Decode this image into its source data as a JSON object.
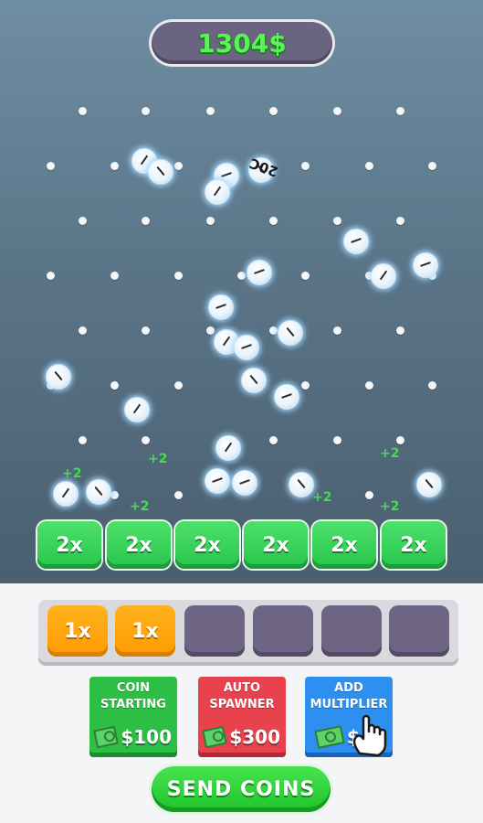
{
  "hud": {
    "money": "1304$"
  },
  "board": {
    "multipliers": [
      "2x",
      "2x",
      "2x",
      "2x",
      "2x",
      "2x"
    ],
    "floating_labels": [
      "20C",
      "+2",
      "+2",
      "+2",
      "+2",
      "+2",
      "+2"
    ]
  },
  "slots": [
    "1x",
    "1x",
    "",
    "",
    "",
    ""
  ],
  "upgrades": [
    {
      "title_line1": "COIN",
      "title_line2": "STARTING",
      "price": "$100",
      "color": "#2dbf44"
    },
    {
      "title_line1": "AUTO",
      "title_line2": "SPAWNER",
      "price": "$300",
      "color": "#e8424f"
    },
    {
      "title_line1": "ADD",
      "title_line2": "MULTIPLIER",
      "price": "$",
      "color": "#2d8ff0"
    }
  ],
  "send_button": "SEND COINS",
  "colors": {
    "money_text": "#5cf25a",
    "multiplier": "#27c54d",
    "slot_filled": "#ff9b00",
    "slot_empty": "#6e6585"
  },
  "icons": [
    "cash-icon",
    "pointer-hand-icon"
  ]
}
